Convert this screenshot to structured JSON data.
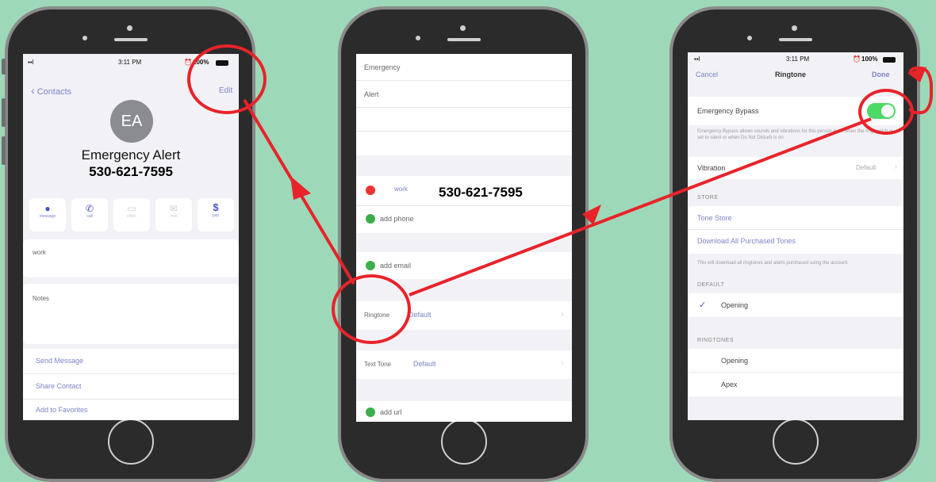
{
  "phone1": {
    "status": {
      "time": "3:11 PM",
      "battery": "100%"
    },
    "nav": {
      "back": "Contacts",
      "edit": "Edit"
    },
    "avatar_initials": "EA",
    "name": "Emergency Alert",
    "phone_number": "530-621-7595",
    "actions": [
      {
        "icon": "message-icon",
        "label": "message"
      },
      {
        "icon": "phone-icon",
        "label": "call"
      },
      {
        "icon": "video-icon",
        "label": "video"
      },
      {
        "icon": "mail-icon",
        "label": "mail"
      },
      {
        "icon": "dollar-icon",
        "label": "pay"
      }
    ],
    "work_label": "work",
    "notes_label": "Notes",
    "links": [
      "Send Message",
      "Share Contact",
      "Add to Favorites"
    ]
  },
  "phone2": {
    "first_name": "Emergency",
    "last_name": "Alert",
    "work_label": "work",
    "phone_overlay": "530-621-7595",
    "add_phone": "add phone",
    "add_email": "add email",
    "ringtone_label": "Ringtone",
    "ringtone_value": "Default",
    "texttone_label": "Text Tone",
    "texttone_value": "Default",
    "add_url": "add url"
  },
  "phone3": {
    "status": {
      "time": "3:11 PM",
      "battery": "100%"
    },
    "nav": {
      "cancel": "Cancel",
      "title": "Ringtone",
      "done": "Done"
    },
    "bypass_label": "Emergency Bypass",
    "bypass_on": true,
    "bypass_desc": "Emergency Bypass allows sounds and vibrations for this person even when the ring switch is set to silent or when Do Not Disturb is on.",
    "vibration_label": "Vibration",
    "vibration_value": "Default",
    "store_header": "STORE",
    "tone_store": "Tone Store",
    "download_all": "Download All Purchased Tones",
    "download_desc": "This will download all ringtones and alerts purchased using the account.",
    "default_header": "DEFAULT",
    "default_item": "Opening",
    "ringtones_header": "RINGTONES",
    "ringtones": [
      "Opening",
      "Apex"
    ]
  },
  "colors": {
    "background": "#9dd9b8",
    "annotation": "#e8232a",
    "link": "#7c83c9",
    "toggle_on": "#4cd964"
  }
}
